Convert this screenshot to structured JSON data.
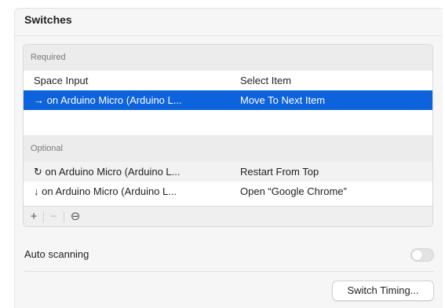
{
  "section": {
    "title": "Switches"
  },
  "table": {
    "required_label": "Required",
    "required_rows": [
      {
        "switch": "Space Input",
        "action": "Select Item"
      },
      {
        "switch": "→ on Arduino Micro (Arduino L...",
        "action": "Move To Next Item"
      }
    ],
    "optional_label": "Optional",
    "optional_rows": [
      {
        "switch": "↻ on Arduino Micro (Arduino L...",
        "action": "Restart From Top"
      },
      {
        "switch": "↓ on Arduino Micro (Arduino L...",
        "action": "Open “Google Chrome”"
      }
    ],
    "footer": {
      "add": "+",
      "remove": "−",
      "more": "⊖"
    }
  },
  "auto_scanning": {
    "label": "Auto scanning",
    "enabled": false
  },
  "switch_timing_button": {
    "label": "Switch Timing..."
  },
  "colors": {
    "selection": "#0d63dc",
    "panel": "#f6f6f6"
  }
}
